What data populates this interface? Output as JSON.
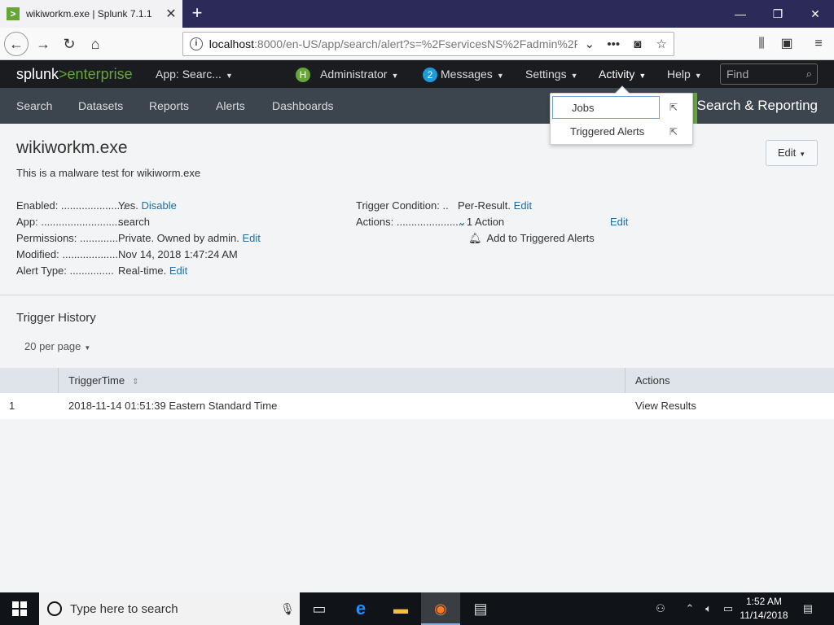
{
  "browser": {
    "tab_title": "wikiworkm.exe | Splunk 7.1.1",
    "tab_icon": "splunk-favicon",
    "url_prefix": "localhost",
    "url_rest": ":8000/en-US/app/search/alert?s=%2FservicesNS%2Fadmin%2Fse",
    "new_tab": "+",
    "minimize": "—",
    "restore": "❐",
    "close": "✕"
  },
  "header": {
    "logo_splunk": "splunk",
    "logo_gt": ">",
    "logo_enterprise": "enterprise",
    "app_menu": "App: Searc...",
    "user_initial": "H",
    "user_menu": "Administrator",
    "messages_count": "2",
    "messages_menu": "Messages",
    "settings_menu": "Settings",
    "activity_menu": "Activity",
    "help_menu": "Help",
    "find_placeholder": "Find"
  },
  "appbar": {
    "nav": [
      "Search",
      "Datasets",
      "Reports",
      "Alerts",
      "Dashboards"
    ],
    "app_title": "Search & Reporting"
  },
  "activity_dropdown": {
    "items": [
      "Jobs",
      "Triggered Alerts"
    ]
  },
  "alert": {
    "title": "wikiworkm.exe",
    "description": "This is a malware test for wikiworm.exe",
    "edit_button": "Edit",
    "left_props": [
      {
        "label": "Enabled: ......................",
        "value": "Yes.",
        "link": "Disable"
      },
      {
        "label": "App: ..............................",
        "value": "search",
        "link": ""
      },
      {
        "label": "Permissions: .............",
        "value": "Private. Owned by admin.",
        "link": "Edit"
      },
      {
        "label": "Modified: ...................",
        "value": "Nov 14, 2018 1:47:24 AM",
        "link": ""
      },
      {
        "label": "Alert Type: ...............",
        "value": "Real-time.",
        "link": "Edit"
      }
    ],
    "trigger_condition_label": "Trigger Condition: ..",
    "trigger_condition_value": "Per-Result.",
    "trigger_condition_link": "Edit",
    "actions_label": "Actions: .......................",
    "actions_value": "1 Action",
    "actions_link": "Edit",
    "action_item": "Add to Triggered Alerts"
  },
  "history": {
    "title": "Trigger History",
    "per_page": "20 per page",
    "columns": [
      "TriggerTime",
      "Actions"
    ],
    "rows": [
      {
        "index": "1",
        "time": "2018-11-14 01:51:39 Eastern Standard Time",
        "action": "View Results"
      }
    ]
  },
  "taskbar": {
    "search_placeholder": "Type here to search",
    "clock_time": "1:52 AM",
    "clock_date": "11/14/2018"
  },
  "colors": {
    "splunk_green": "#65a637",
    "link_blue": "#1e6ea7",
    "header_bg": "#1a1c20",
    "appbar_bg": "#3c444d"
  }
}
